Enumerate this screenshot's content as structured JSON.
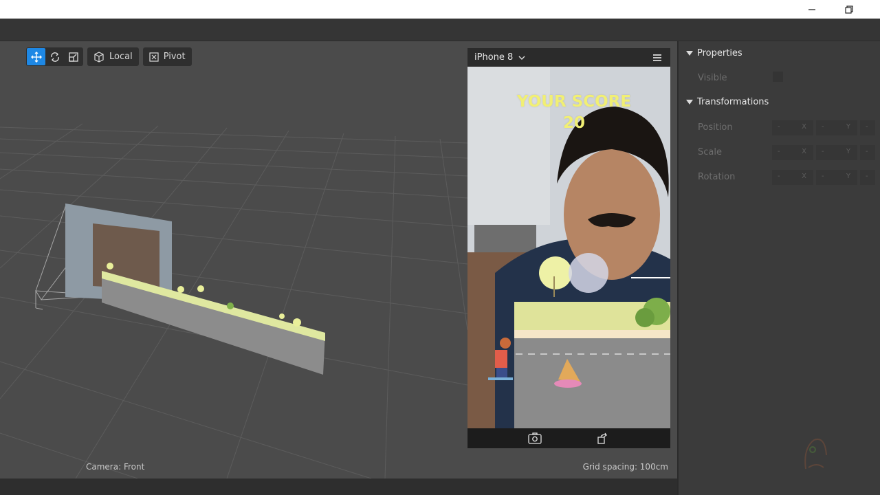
{
  "window": {
    "minimize_icon": "minimize-icon",
    "restore_icon": "restore-icon"
  },
  "toolbar": {
    "local_label": "Local",
    "pivot_label": "Pivot",
    "accent": "#1e88e5"
  },
  "viewport": {
    "camera_label": "Camera: Front",
    "grid_label": "Grid spacing: 100cm"
  },
  "preview": {
    "device": "iPhone 8",
    "score_title": "YOUR SCORE",
    "score_value": "20",
    "score_color": "#f1ef74"
  },
  "properties": {
    "section_properties": "Properties",
    "visible_label": "Visible",
    "section_transformations": "Transformations",
    "rows": [
      {
        "label": "Position",
        "values": [
          "-",
          "-",
          "-"
        ],
        "axes": [
          "X",
          "Y",
          ""
        ]
      },
      {
        "label": "Scale",
        "values": [
          "-",
          "-",
          "-"
        ],
        "axes": [
          "X",
          "Y",
          ""
        ]
      },
      {
        "label": "Rotation",
        "values": [
          "-",
          "-",
          "-"
        ],
        "axes": [
          "X",
          "Y",
          ""
        ]
      }
    ]
  }
}
